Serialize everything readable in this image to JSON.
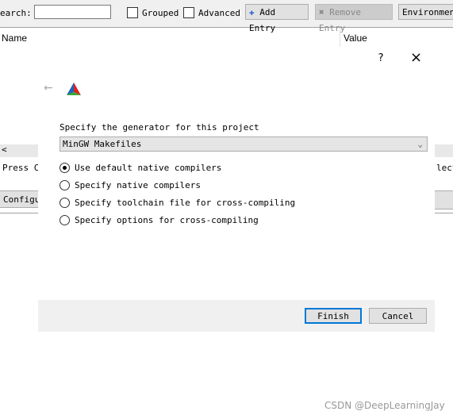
{
  "toolbar": {
    "search_label": "earch:",
    "search_value": "",
    "grouped": "Grouped",
    "advanced": "Advanced",
    "add_entry": "Add Entry",
    "remove_entry": "Remove Entry",
    "environment": "Environment"
  },
  "table": {
    "col_name": "Name",
    "col_value": "Value"
  },
  "background": {
    "press_text": "Press Co",
    "select_text": "lect",
    "configure": "Configu",
    "scroll_left": "<"
  },
  "dialog": {
    "help": "?",
    "close": "×",
    "back": "←",
    "prompt": "Specify the generator for this project",
    "generator": "MinGW Makefiles",
    "options": [
      {
        "label": "Use default native compilers",
        "checked": true
      },
      {
        "label": "Specify native compilers",
        "checked": false
      },
      {
        "label": "Specify toolchain file for cross-compiling",
        "checked": false
      },
      {
        "label": "Specify options for cross-compiling",
        "checked": false
      }
    ],
    "finish": "Finish",
    "cancel": "Cancel"
  },
  "watermark": "CSDN @DeepLearningJay"
}
